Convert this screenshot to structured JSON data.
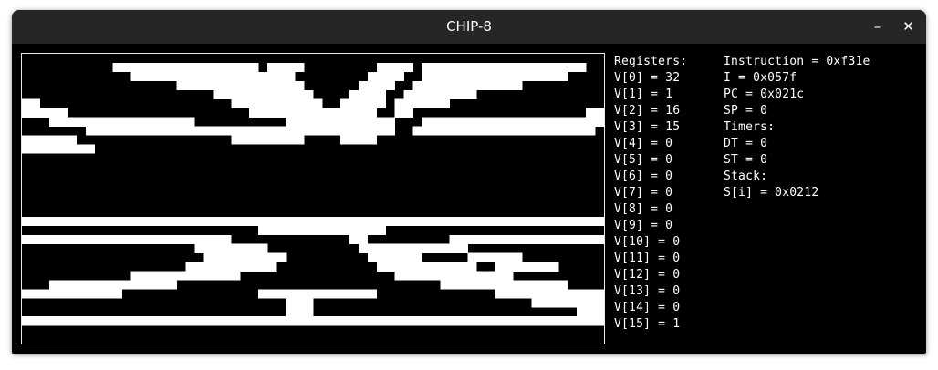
{
  "window": {
    "title": "CHIP-8"
  },
  "controls": {
    "minimize": "–",
    "close": "✕"
  },
  "display": {
    "cols": 64,
    "rows": 32,
    "fg": "#ffffff",
    "bg": "#000000",
    "pixels": [
      "0000000000000000000000000000000000000000000000000000000000000000",
      "0000000000111111111111111101111000000001111011111111111111111100",
      "0000000000001111111111111111110000000011110011111111111111110000",
      "0000000000000000011111111111111000000111100111111111111000000000",
      "0000000000000000000001111111111100001111001111111100000000000000",
      "1100000000000000000000011111111110011111011111100000000000000000",
      "1111100000000000000000000111111111111110011000000000000000000011",
      "0001111111111111111000000000011111111111100011111111111111111111",
      "0000000111111111111111111111111111111111100111111111111111111110",
      "1111110000000000000000011111111000011110000000000000000000000000",
      "1111111100000000000000000000000000000000000000000000000000000000",
      "0000000000000000000000000000000000000000000000000000000000000000",
      "0000000000000000000000000000000000000000000000000000000000000000",
      "0000000000000000000000000000000000000000000000000000000000000000",
      "0000000000000000000000000000000000000000000000000000000000000000",
      "0000000000000000000000000000000000000000000000000000000000000000",
      "0000000000000000000000000000000000000000000000000000000000000000",
      "0000000000000000000000000000000000000000000000000000000000000000",
      "1111111111111111111111111111111111111111111111111111111111111111",
      "0000000000000000000000000011111111111111000000000000000000000000",
      "1111111111111111111111100000000000001100000000011111111111111111",
      "0000000000000000000111111110000000000111111111111000000000000000",
      "0000000000000000000011111111100000000011111100000111111000000000",
      "0000000000000000001111111111000000000001111111111100111111100000",
      "0000000000001111111111110000000000000000011111111111110000000000",
      "0001111111111111100000000000000000000000000000111111111111110000",
      "1111111111100000000000000011111111111110000000000000111111111111",
      "0000000000000000000000000000011100000000000000000000000011111111",
      "0000000000000000000000000000011100000000000000000000000000000111",
      "1111111111111111111111111111111111111111111111111111111111111111",
      "0000000000000000000000000000000000000000000000000000000000000000",
      "0000000000000000000000000000000000000000000000000000000000000000"
    ]
  },
  "registers": {
    "heading": "Registers:",
    "values": [
      "V[0] = 32",
      "V[1] = 1",
      "V[2] = 16",
      "V[3] = 15",
      "V[4] = 0",
      "V[5] = 0",
      "V[6] = 0",
      "V[7] = 0",
      "V[8] = 0",
      "V[9] = 0",
      "V[10] = 0",
      "V[11] = 0",
      "V[12] = 0",
      "V[13] = 0",
      "V[14] = 0",
      "V[15] = 1"
    ]
  },
  "state": {
    "instruction": "Instruction = 0xf31e",
    "i": "I = 0x057f",
    "pc": "PC = 0x021c",
    "sp": "SP = 0",
    "timers_heading": "Timers:",
    "dt": "DT = 0",
    "st": "ST = 0",
    "stack_heading": "Stack:",
    "stack": [
      "S[i] = 0x0212"
    ]
  }
}
